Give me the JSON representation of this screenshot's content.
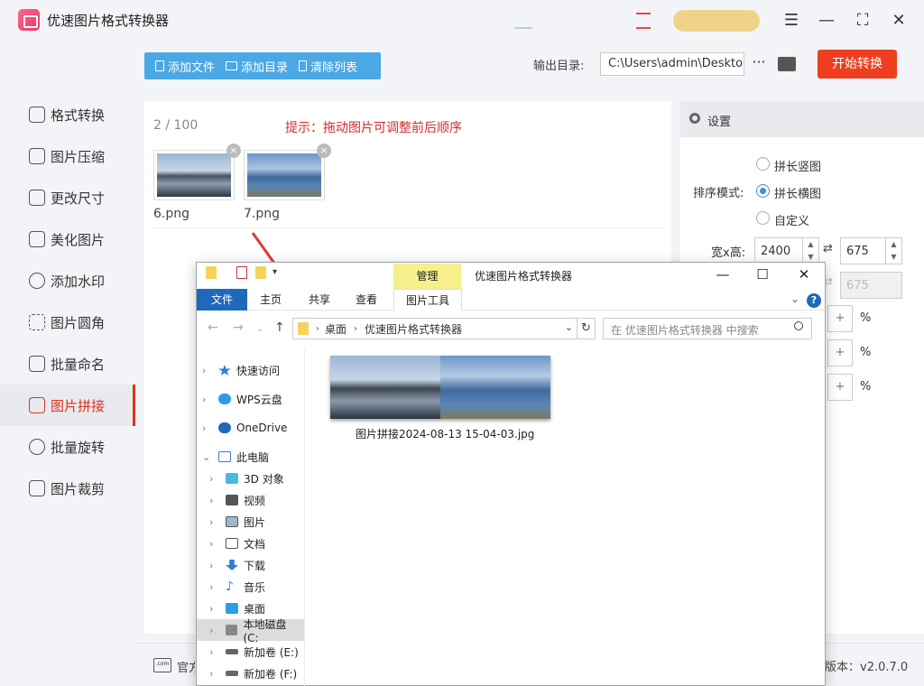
{
  "app": {
    "title": "优速图片格式转换器"
  },
  "window_controls": {
    "menu_icon": "menu-icon",
    "minimize": "—",
    "fullscreen": "⛶",
    "close": "✕"
  },
  "sidebar": {
    "items": [
      {
        "label": "格式转换",
        "icon": "convert-icon"
      },
      {
        "label": "图片压缩",
        "icon": "compress-icon"
      },
      {
        "label": "更改尺寸",
        "icon": "resize-icon"
      },
      {
        "label": "美化图片",
        "icon": "beautify-icon"
      },
      {
        "label": "添加水印",
        "icon": "watermark-icon"
      },
      {
        "label": "图片圆角",
        "icon": "round-corner-icon"
      },
      {
        "label": "批量命名",
        "icon": "rename-icon"
      },
      {
        "label": "图片拼接",
        "icon": "stitch-icon",
        "active": true
      },
      {
        "label": "批量旋转",
        "icon": "rotate-icon"
      },
      {
        "label": "图片裁剪",
        "icon": "crop-icon"
      }
    ]
  },
  "toolbar": {
    "add_file": "添加文件",
    "add_dir": "添加目录",
    "clear_list": "清除列表"
  },
  "output": {
    "label": "输出目录:",
    "path": "C:\\Users\\admin\\Deskto",
    "more": "···"
  },
  "start_button": "开始转换",
  "list": {
    "count": "2 / 100",
    "hint": "提示：拖动图片可调整前后顺序",
    "files": [
      {
        "name": "6.png",
        "remove": "×"
      },
      {
        "name": "7.png",
        "remove": "×"
      }
    ]
  },
  "settings": {
    "title": "设置",
    "sort_label": "排序模式:",
    "sort_options": [
      "拼长竖图",
      "拼长横图",
      "自定义"
    ],
    "sort_selected": "拼长横图",
    "size_label": "宽x高:",
    "width": "2400",
    "height": "675",
    "height2": "675",
    "percent": "%",
    "plus": "+"
  },
  "footer": {
    "site": "官方",
    "site_icon": ".com",
    "version": "版本：v2.0.7.0"
  },
  "explorer": {
    "title": "优速图片格式转换器",
    "manage_tab": "管理",
    "ribbon_tabs": [
      "文件",
      "主页",
      "共享",
      "查看",
      "图片工具"
    ],
    "address": [
      "桌面",
      "优速图片格式转换器"
    ],
    "search_placeholder": "在 优速图片格式转换器 中搜索",
    "nav": [
      {
        "label": "快速访问",
        "icon": "star-icon"
      },
      {
        "label": "WPS云盘",
        "icon": "cloud-icon"
      },
      {
        "label": "OneDrive",
        "icon": "onedrive-icon"
      },
      {
        "label": "此电脑",
        "icon": "computer-icon"
      },
      {
        "label": "3D 对象",
        "icon": "cube-icon"
      },
      {
        "label": "视频",
        "icon": "video-icon"
      },
      {
        "label": "图片",
        "icon": "picture-icon"
      },
      {
        "label": "文档",
        "icon": "document-icon"
      },
      {
        "label": "下载",
        "icon": "download-icon"
      },
      {
        "label": "音乐",
        "icon": "music-icon"
      },
      {
        "label": "桌面",
        "icon": "desktop-icon"
      },
      {
        "label": "本地磁盘 (C:",
        "icon": "drive-c-icon"
      },
      {
        "label": "新加卷 (E:)",
        "icon": "drive-icon"
      },
      {
        "label": "新加卷 (F:)",
        "icon": "drive-icon"
      }
    ],
    "result_file": "图片拼接2024-08-13 15-04-03.jpg"
  },
  "colors": {
    "accent_red": "#ef3e1f",
    "toolbar_blue": "#4aa8e5",
    "active_red": "#e0311b",
    "explorer_blue": "#1e69bd"
  }
}
